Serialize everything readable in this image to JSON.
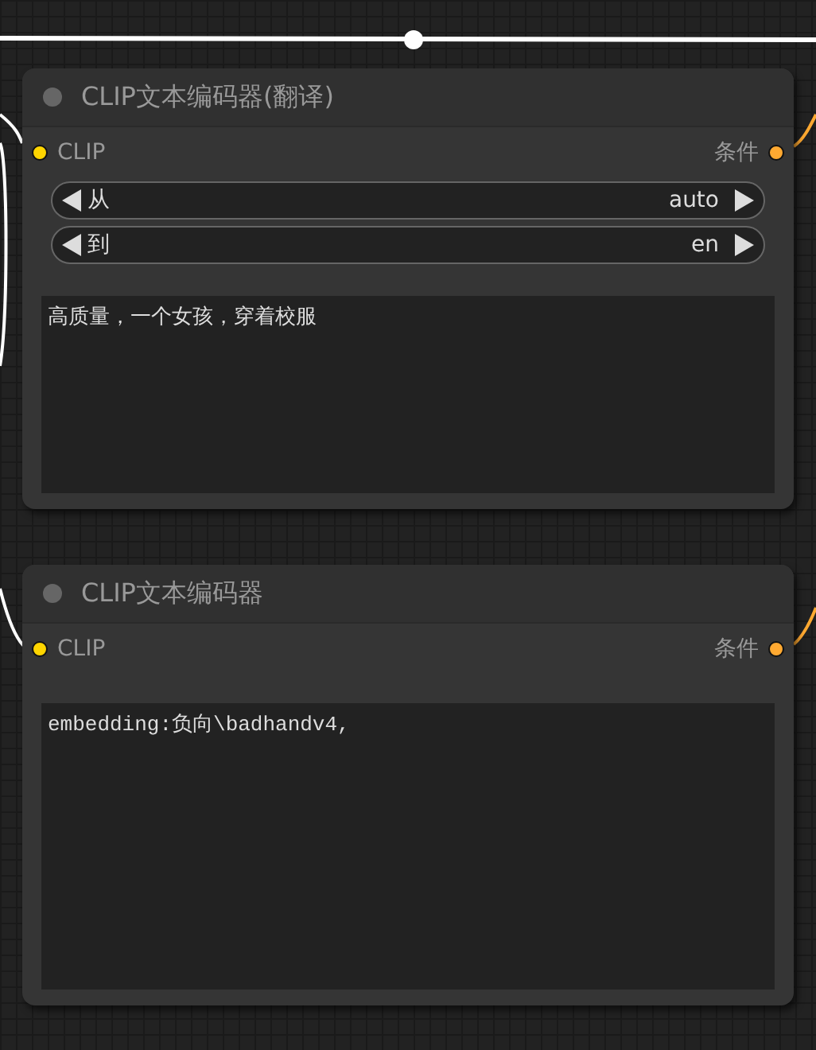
{
  "nodes": [
    {
      "title": "CLIP文本编码器(翻译)",
      "inputs": [
        {
          "label": "CLIP",
          "color": "#ffd500"
        }
      ],
      "outputs": [
        {
          "label": "条件",
          "color": "#ffa931"
        }
      ],
      "widgets": [
        {
          "kind": "combo",
          "label": "从",
          "value": "auto"
        },
        {
          "kind": "combo",
          "label": "到",
          "value": "en"
        },
        {
          "kind": "text",
          "value": "高质量，一个女孩，穿着校服"
        }
      ]
    },
    {
      "title": "CLIP文本编码器",
      "inputs": [
        {
          "label": "CLIP",
          "color": "#ffd500"
        }
      ],
      "outputs": [
        {
          "label": "条件",
          "color": "#ffa931"
        }
      ],
      "widgets": [
        {
          "kind": "text",
          "value": "embedding:负向\\badhandv4,"
        }
      ]
    }
  ]
}
